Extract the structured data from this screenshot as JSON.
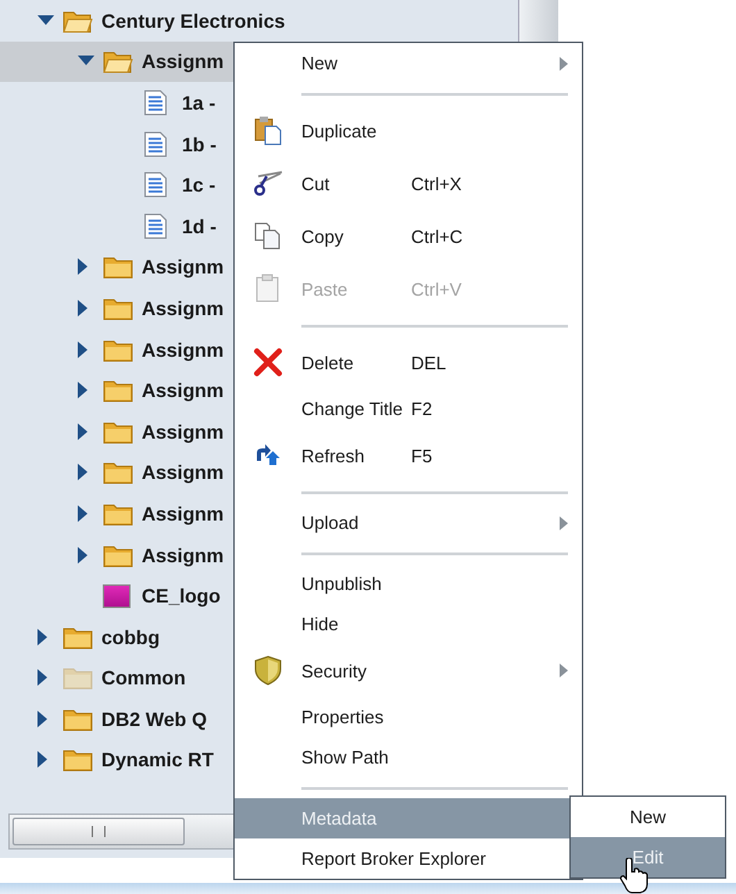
{
  "tree": [
    {
      "label": "Century Electronics",
      "kind": "folder",
      "expanded": true,
      "selected": false,
      "children": [
        {
          "label": "Assignm",
          "kind": "folder",
          "expanded": true,
          "selected": true,
          "children": [
            {
              "label": "1a -",
              "kind": "document",
              "selected": false
            },
            {
              "label": "1b -",
              "kind": "document",
              "selected": false
            },
            {
              "label": "1c -",
              "kind": "document",
              "selected": false
            },
            {
              "label": "1d -",
              "kind": "document",
              "selected": false
            }
          ]
        },
        {
          "label": "Assignm",
          "kind": "folder",
          "expanded": false,
          "selected": false
        },
        {
          "label": "Assignm",
          "kind": "folder",
          "expanded": false,
          "selected": false
        },
        {
          "label": "Assignm",
          "kind": "folder",
          "expanded": false,
          "selected": false
        },
        {
          "label": "Assignm",
          "kind": "folder",
          "expanded": false,
          "selected": false
        },
        {
          "label": "Assignm",
          "kind": "folder",
          "expanded": false,
          "selected": false
        },
        {
          "label": "Assignm",
          "kind": "folder",
          "expanded": false,
          "selected": false
        },
        {
          "label": "Assignm",
          "kind": "folder",
          "expanded": false,
          "selected": false
        },
        {
          "label": "Assignm",
          "kind": "folder",
          "expanded": false,
          "selected": false
        },
        {
          "label": "CE_logo",
          "kind": "gif",
          "selected": false
        }
      ]
    },
    {
      "label": "cobbg",
      "kind": "folder",
      "expanded": false,
      "selected": false
    },
    {
      "label": "Common",
      "kind": "hidden-folder",
      "expanded": false,
      "selected": false
    },
    {
      "label": "DB2 Web Q",
      "kind": "folder",
      "expanded": false,
      "selected": false
    },
    {
      "label": "Dynamic RT",
      "kind": "folder",
      "expanded": false,
      "selected": false
    }
  ],
  "context_menu": [
    {
      "kind": "item",
      "label": "New",
      "submenu": true,
      "disabled": false,
      "selected": false
    },
    {
      "kind": "separator"
    },
    {
      "kind": "item",
      "label": "Duplicate",
      "disabled": false,
      "selected": false
    },
    {
      "kind": "item",
      "label": "Cut",
      "shortcut": "Ctrl+X",
      "disabled": false,
      "selected": false
    },
    {
      "kind": "item",
      "label": "Copy",
      "shortcut": "Ctrl+C",
      "disabled": false,
      "selected": false
    },
    {
      "kind": "item",
      "label": "Paste",
      "shortcut": "Ctrl+V",
      "disabled": true,
      "selected": false
    },
    {
      "kind": "separator"
    },
    {
      "kind": "item",
      "label": "Delete",
      "shortcut": "DEL",
      "disabled": false,
      "selected": false
    },
    {
      "kind": "item",
      "label": "Change Title",
      "shortcut": "F2",
      "disabled": false,
      "selected": false
    },
    {
      "kind": "item",
      "label": "Refresh",
      "shortcut": "F5",
      "disabled": false,
      "selected": false
    },
    {
      "kind": "separator"
    },
    {
      "kind": "item",
      "label": "Upload",
      "submenu": true,
      "disabled": false,
      "selected": false
    },
    {
      "kind": "separator"
    },
    {
      "kind": "item",
      "label": "Unpublish",
      "disabled": false,
      "selected": false
    },
    {
      "kind": "item",
      "label": "Hide",
      "disabled": false,
      "selected": false
    },
    {
      "kind": "item",
      "label": "Security",
      "submenu": true,
      "disabled": false,
      "selected": false
    },
    {
      "kind": "item",
      "label": "Properties",
      "disabled": false,
      "selected": false
    },
    {
      "kind": "item",
      "label": "Show Path",
      "disabled": false,
      "selected": false
    },
    {
      "kind": "separator"
    },
    {
      "kind": "item",
      "label": "Metadata",
      "disabled": false,
      "selected": true
    },
    {
      "kind": "item",
      "label": "Report Broker Explorer",
      "disabled": false,
      "selected": false
    }
  ],
  "submenu": [
    {
      "label": "New",
      "selected": false
    },
    {
      "label": "Edit",
      "selected": true
    }
  ]
}
